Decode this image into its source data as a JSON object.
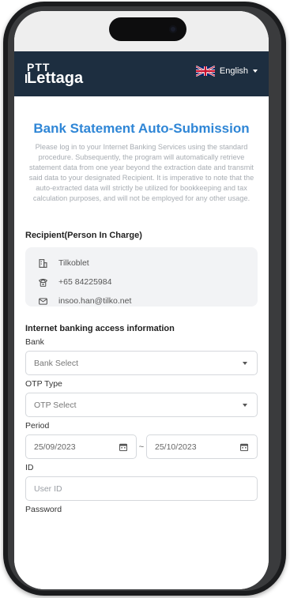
{
  "header": {
    "logo_line1": "PTT",
    "logo_line2": "Lettaga",
    "language": "English"
  },
  "page": {
    "title": "Bank Statement Auto-Submission",
    "intro": "Please log in to your Internet Banking Services using the standard procedure. Subsequently, the program will automatically retrieve statement data from one year beyond the extraction date and transmit said data to your designated Recipient. It is imperative to note that the auto-extracted data will strictly be utilized for bookkeeping and tax calculation purposes, and will not be employed for any other usage."
  },
  "recipient": {
    "section_title": "Recipient(Person In Charge)",
    "company": "Tilkoblet",
    "phone": "+65 84225984",
    "email": "insoo.han@tilko.net"
  },
  "banking": {
    "section_title": "Internet banking access information",
    "bank_label": "Bank",
    "bank_value": "Bank Select",
    "otp_label": "OTP Type",
    "otp_value": "OTP Select",
    "period_label": "Period",
    "period_start": "25/09/2023",
    "period_sep": "~",
    "period_end": "25/10/2023",
    "id_label": "ID",
    "id_placeholder": "User ID",
    "password_label": "Password"
  },
  "colors": {
    "header_bg": "#1d2e40",
    "title_blue": "#2f86d6"
  },
  "icons": [
    "building-icon",
    "phone-icon",
    "mail-icon",
    "calendar-icon",
    "dropdown-caret-icon",
    "uk-flag-icon"
  ]
}
